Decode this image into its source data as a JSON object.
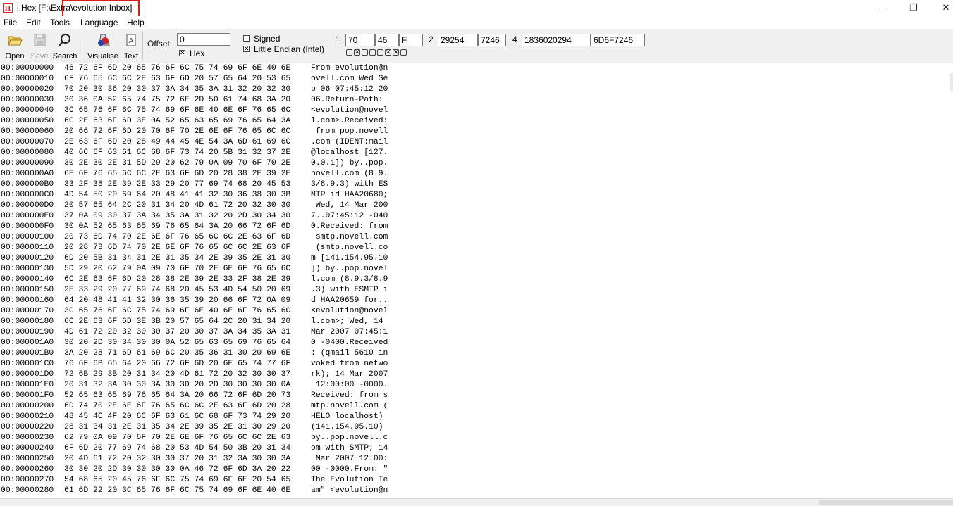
{
  "window": {
    "app_icon_letter": "H",
    "title": "i.Hex [F:\\Extra\\evolution Inbox]",
    "minimize_glyph": "—",
    "maximize_glyph": "❐",
    "close_glyph": "✕"
  },
  "menu": [
    "File",
    "Edit",
    "Tools",
    "Language",
    "Help"
  ],
  "toolbar": {
    "open_label": "Open",
    "save_label": "Save",
    "search_label": "Search",
    "visualise_label": "Visualise",
    "text_label": "Text",
    "offset_label": "Offset:",
    "offset_value": "0",
    "hex_label": "Hex",
    "hex_checked": true,
    "signed_label": "Signed",
    "signed_checked": false,
    "little_endian_label": "Little Endian (Intel)",
    "little_endian_checked": true,
    "group1_label": "1",
    "byte_dec": "70",
    "byte_hex": "46",
    "byte_char": "F",
    "group2_label": "2",
    "word_dec": "29254",
    "word_hex": "7246",
    "group4_label": "4",
    "dword_dec": "1836020294",
    "dword_hex": "6D6F7246",
    "bits": [
      false,
      true,
      false,
      false,
      false,
      true,
      true,
      false
    ],
    "icons": [
      "open-folder-icon",
      "save-disk-icon",
      "magnifier-search-icon",
      "visualise-chart-icon",
      "text-document-icon"
    ]
  },
  "rows": [
    {
      "offset": "00:00000000",
      "hex": "46 72 6F 6D 20 65 76 6F 6C 75 74 69 6F 6E 40 6E",
      "text": "From evolution@n"
    },
    {
      "offset": "00:00000010",
      "hex": "6F 76 65 6C 6C 2E 63 6F 6D 20 57 65 64 20 53 65",
      "text": "ovell.com Wed Se"
    },
    {
      "offset": "00:00000020",
      "hex": "70 20 30 36 20 30 37 3A 34 35 3A 31 32 20 32 30",
      "text": "p 06 07:45:12 20"
    },
    {
      "offset": "00:00000030",
      "hex": "30 36 0A 52 65 74 75 72 6E 2D 50 61 74 68 3A 20",
      "text": "06.Return-Path: "
    },
    {
      "offset": "00:00000040",
      "hex": "3C 65 76 6F 6C 75 74 69 6F 6E 40 6E 6F 76 65 6C",
      "text": "<evolution@novel"
    },
    {
      "offset": "00:00000050",
      "hex": "6C 2E 63 6F 6D 3E 0A 52 65 63 65 69 76 65 64 3A",
      "text": "l.com>.Received:"
    },
    {
      "offset": "00:00000060",
      "hex": "20 66 72 6F 6D 20 70 6F 70 2E 6E 6F 76 65 6C 6C",
      "text": " from pop.novell"
    },
    {
      "offset": "00:00000070",
      "hex": "2E 63 6F 6D 20 28 49 44 45 4E 54 3A 6D 61 69 6C",
      "text": ".com (IDENT:mail"
    },
    {
      "offset": "00:00000080",
      "hex": "40 6C 6F 63 61 6C 68 6F 73 74 20 5B 31 32 37 2E",
      "text": "@localhost [127."
    },
    {
      "offset": "00:00000090",
      "hex": "30 2E 30 2E 31 5D 29 20 62 79 0A 09 70 6F 70 2E",
      "text": "0.0.1]) by..pop."
    },
    {
      "offset": "00:000000A0",
      "hex": "6E 6F 76 65 6C 6C 2E 63 6F 6D 20 28 38 2E 39 2E",
      "text": "novell.com (8.9."
    },
    {
      "offset": "00:000000B0",
      "hex": "33 2F 38 2E 39 2E 33 29 20 77 69 74 68 20 45 53",
      "text": "3/8.9.3) with ES"
    },
    {
      "offset": "00:000000C0",
      "hex": "4D 54 50 20 69 64 20 48 41 41 32 30 36 38 30 3B",
      "text": "MTP id HAA20680;"
    },
    {
      "offset": "00:000000D0",
      "hex": "20 57 65 64 2C 20 31 34 20 4D 61 72 20 32 30 30",
      "text": " Wed, 14 Mar 200"
    },
    {
      "offset": "00:000000E0",
      "hex": "37 0A 09 30 37 3A 34 35 3A 31 32 20 2D 30 34 30",
      "text": "7..07:45:12 -040"
    },
    {
      "offset": "00:000000F0",
      "hex": "30 0A 52 65 63 65 69 76 65 64 3A 20 66 72 6F 6D",
      "text": "0.Received: from"
    },
    {
      "offset": "00:00000100",
      "hex": "20 73 6D 74 70 2E 6E 6F 76 65 6C 6C 2E 63 6F 6D",
      "text": " smtp.novell.com"
    },
    {
      "offset": "00:00000110",
      "hex": "20 28 73 6D 74 70 2E 6E 6F 76 65 6C 6C 2E 63 6F",
      "text": " (smtp.novell.co"
    },
    {
      "offset": "00:00000120",
      "hex": "6D 20 5B 31 34 31 2E 31 35 34 2E 39 35 2E 31 30",
      "text": "m [141.154.95.10"
    },
    {
      "offset": "00:00000130",
      "hex": "5D 29 20 62 79 0A 09 70 6F 70 2E 6E 6F 76 65 6C",
      "text": "]) by..pop.novel"
    },
    {
      "offset": "00:00000140",
      "hex": "6C 2E 63 6F 6D 20 28 38 2E 39 2E 33 2F 38 2E 39",
      "text": "l.com (8.9.3/8.9"
    },
    {
      "offset": "00:00000150",
      "hex": "2E 33 29 20 77 69 74 68 20 45 53 4D 54 50 20 69",
      "text": ".3) with ESMTP i"
    },
    {
      "offset": "00:00000160",
      "hex": "64 20 48 41 41 32 30 36 35 39 20 66 6F 72 0A 09",
      "text": "d HAA20659 for.."
    },
    {
      "offset": "00:00000170",
      "hex": "3C 65 76 6F 6C 75 74 69 6F 6E 40 6E 6F 76 65 6C",
      "text": "<evolution@novel"
    },
    {
      "offset": "00:00000180",
      "hex": "6C 2E 63 6F 6D 3E 3B 20 57 65 64 2C 20 31 34 20",
      "text": "l.com>; Wed, 14 "
    },
    {
      "offset": "00:00000190",
      "hex": "4D 61 72 20 32 30 30 37 20 30 37 3A 34 35 3A 31",
      "text": "Mar 2007 07:45:1"
    },
    {
      "offset": "00:000001A0",
      "hex": "30 20 2D 30 34 30 30 0A 52 65 63 65 69 76 65 64",
      "text": "0 -0400.Received"
    },
    {
      "offset": "00:000001B0",
      "hex": "3A 20 28 71 6D 61 69 6C 20 35 36 31 30 20 69 6E",
      "text": ": (qmail 5610 in"
    },
    {
      "offset": "00:000001C0",
      "hex": "76 6F 6B 65 64 20 66 72 6F 6D 20 6E 65 74 77 6F",
      "text": "voked from netwo"
    },
    {
      "offset": "00:000001D0",
      "hex": "72 6B 29 3B 20 31 34 20 4D 61 72 20 32 30 30 37",
      "text": "rk); 14 Mar 2007"
    },
    {
      "offset": "00:000001E0",
      "hex": "20 31 32 3A 30 30 3A 30 30 20 2D 30 30 30 30 0A",
      "text": " 12:00:00 -0000."
    },
    {
      "offset": "00:000001F0",
      "hex": "52 65 63 65 69 76 65 64 3A 20 66 72 6F 6D 20 73",
      "text": "Received: from s"
    },
    {
      "offset": "00:00000200",
      "hex": "6D 74 70 2E 6E 6F 76 65 6C 6C 2E 63 6F 6D 20 28",
      "text": "mtp.novell.com ("
    },
    {
      "offset": "00:00000210",
      "hex": "48 45 4C 4F 20 6C 6F 63 61 6C 68 6F 73 74 29 20",
      "text": "HELO localhost) "
    },
    {
      "offset": "00:00000220",
      "hex": "28 31 34 31 2E 31 35 34 2E 39 35 2E 31 30 29 20",
      "text": "(141.154.95.10) "
    },
    {
      "offset": "00:00000230",
      "hex": "62 79 0A 09 70 6F 70 2E 6E 6F 76 65 6C 6C 2E 63",
      "text": "by..pop.novell.c"
    },
    {
      "offset": "00:00000240",
      "hex": "6F 6D 20 77 69 74 68 20 53 4D 54 50 3B 20 31 34",
      "text": "om with SMTP; 14"
    },
    {
      "offset": "00:00000250",
      "hex": "20 4D 61 72 20 32 30 30 37 20 31 32 3A 30 30 3A",
      "text": " Mar 2007 12:00:"
    },
    {
      "offset": "00:00000260",
      "hex": "30 30 20 2D 30 30 30 30 0A 46 72 6F 6D 3A 20 22",
      "text": "00 -0000.From: \""
    },
    {
      "offset": "00:00000270",
      "hex": "54 68 65 20 45 76 6F 6C 75 74 69 6F 6E 20 54 65",
      "text": "The Evolution Te"
    },
    {
      "offset": "00:00000280",
      "hex": "61 6D 22 20 3C 65 76 6F 6C 75 74 69 6F 6E 40 6E",
      "text": "am\" <evolution@n"
    }
  ]
}
